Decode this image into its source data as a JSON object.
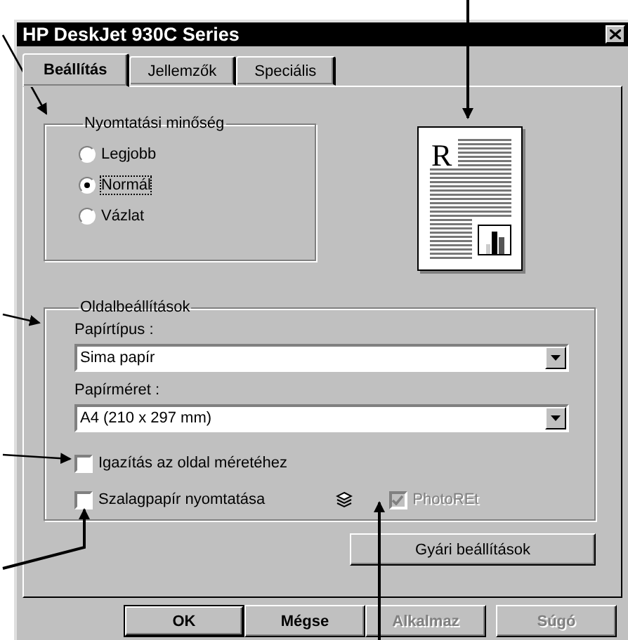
{
  "window": {
    "title": "HP DeskJet 930C Series"
  },
  "tabs": [
    {
      "label": "Beállítás",
      "selected": true
    },
    {
      "label": "Jellemzők",
      "selected": false
    },
    {
      "label": "Speciális",
      "selected": false
    }
  ],
  "print_quality": {
    "title": "Nyomtatási minőség",
    "options": [
      {
        "label": "Legjobb",
        "selected": false
      },
      {
        "label": "Normál",
        "selected": true
      },
      {
        "label": "Vázlat",
        "selected": false
      }
    ]
  },
  "preview": {
    "letter": "R"
  },
  "page_settings": {
    "title": "Oldalbeállítások",
    "paper_type": {
      "label": "Papírtípus :",
      "value": "Sima papír"
    },
    "paper_size": {
      "label": "Papírméret :",
      "value": "A4 (210 x 297 mm)"
    },
    "checkboxes": [
      {
        "label": "Igazítás az oldal méretéhez",
        "checked": false,
        "disabled": false
      },
      {
        "label": "Szalagpapír nyomtatása",
        "checked": false,
        "disabled": false
      },
      {
        "label": "PhotoREt",
        "checked": true,
        "disabled": true
      }
    ]
  },
  "defaults_button": "Gyári beállítások",
  "buttons": [
    {
      "label": "OK",
      "default": true,
      "disabled": false
    },
    {
      "label": "Mégse",
      "default": false,
      "disabled": false
    },
    {
      "label": "Alkalmaz",
      "default": false,
      "disabled": true
    },
    {
      "label": "Súgó",
      "default": false,
      "disabled": true
    }
  ]
}
